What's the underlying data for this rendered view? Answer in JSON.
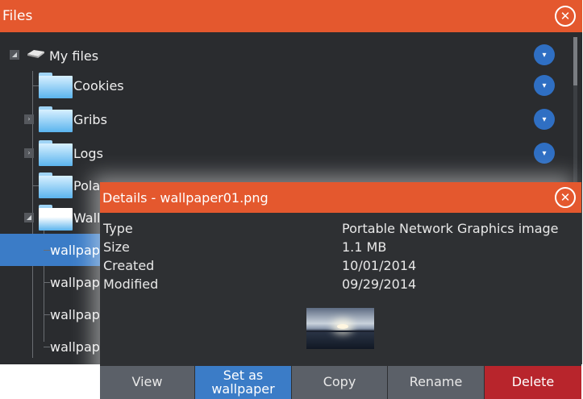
{
  "files_window": {
    "title": "Files",
    "close_glyph": "✕"
  },
  "tree": {
    "root": {
      "label": "My files",
      "icon": "drive-icon"
    },
    "items": [
      {
        "label": "Cookies"
      },
      {
        "label": "Gribs"
      },
      {
        "label": "Logs"
      },
      {
        "label": "Pola"
      },
      {
        "label": "Wall"
      },
      {
        "label": "wallpap"
      },
      {
        "label": "wallpap"
      },
      {
        "label": "wallpap"
      },
      {
        "label": "wallpap"
      }
    ],
    "more_glyph": "▾"
  },
  "details": {
    "title": "Details - wallpaper01.png",
    "close_glyph": "✕",
    "properties": [
      {
        "label": "Type",
        "value": "Portable Network Graphics image"
      },
      {
        "label": "Size",
        "value": "1.1 MB"
      },
      {
        "label": "Created",
        "value": "10/01/2014"
      },
      {
        "label": "Modified",
        "value": "09/29/2014"
      }
    ],
    "buttons": {
      "view": "View",
      "set_as_wallpaper": "Set as wallpaper",
      "copy": "Copy",
      "rename": "Rename",
      "delete": "Delete"
    }
  },
  "colors": {
    "title_bar": "#e4582e",
    "selection": "#3b7cc7",
    "delete": "#b8252c"
  }
}
